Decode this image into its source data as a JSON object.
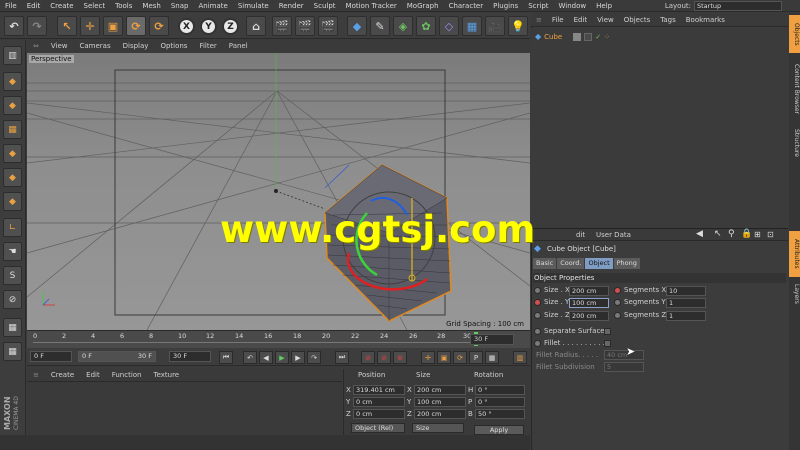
{
  "menubar": {
    "items": [
      "File",
      "Edit",
      "Create",
      "Select",
      "Tools",
      "Mesh",
      "Snap",
      "Animate",
      "Simulate",
      "Render",
      "Sculpt",
      "Motion Tracker",
      "MoGraph",
      "Character",
      "Plugins",
      "Script",
      "Window",
      "Help"
    ],
    "layout_label": "Layout:",
    "layout_value": "Startup"
  },
  "toolbar": {
    "axis_x": "X",
    "axis_y": "Y",
    "axis_z": "Z"
  },
  "viewport": {
    "menu": [
      "View",
      "Cameras",
      "Display",
      "Options",
      "Filter",
      "Panel"
    ],
    "label": "Perspective",
    "grid_spacing": "Grid Spacing : 100 cm",
    "watermark": "www.cgtsj.com"
  },
  "timeline": {
    "ticks": [
      "0",
      "2",
      "4",
      "6",
      "8",
      "10",
      "12",
      "14",
      "16",
      "18",
      "20",
      "22",
      "24",
      "26",
      "28",
      "30"
    ],
    "current_frame": "30 F"
  },
  "playback": {
    "start": "0 F",
    "min": "0 F",
    "max": "30 F",
    "end": "30 F"
  },
  "material_manager": {
    "menu": [
      "Create",
      "Edit",
      "Function",
      "Texture"
    ]
  },
  "coordinates": {
    "headers": {
      "position": "Position",
      "size": "Size",
      "rotation": "Rotation"
    },
    "rows": [
      {
        "axis": "X",
        "pos": "319.401 cm",
        "size_axis": "X",
        "size": "200 cm",
        "rot_axis": "H",
        "rot": "0 °"
      },
      {
        "axis": "Y",
        "pos": "0 cm",
        "size_axis": "Y",
        "size": "100 cm",
        "rot_axis": "P",
        "rot": "0 °"
      },
      {
        "axis": "Z",
        "pos": "0 cm",
        "size_axis": "Z",
        "size": "200 cm",
        "rot_axis": "B",
        "rot": "50 °"
      }
    ],
    "mode": "Object (Rel)",
    "size_mode": "Size",
    "apply": "Apply"
  },
  "object_manager": {
    "menu": [
      "File",
      "Edit",
      "View",
      "Objects",
      "Tags",
      "Bookmarks"
    ],
    "objects": [
      {
        "name": "Cube"
      }
    ]
  },
  "attributes": {
    "header_tabs": [
      "dit",
      "User Data"
    ],
    "title": "Cube Object [Cube]",
    "tabs": [
      "Basic",
      "Coord.",
      "Object",
      "Phong"
    ],
    "active_tab": "Object",
    "section": "Object Properties",
    "size_x_label": "Size . X",
    "size_x": "200 cm",
    "size_y_label": "Size . Y",
    "size_y": "100 cm",
    "size_z_label": "Size . Z",
    "size_z": "200 cm",
    "seg_x_label": "Segments X",
    "seg_x": "10",
    "seg_y_label": "Segments Y",
    "seg_y": "1",
    "seg_z_label": "Segments Z",
    "seg_z": "1",
    "separate_surfaces": "Separate Surfaces",
    "fillet": "Fillet . . . . . . . . . .",
    "fillet_radius_label": "Fillet Radius. . . . .",
    "fillet_radius": "40 cm",
    "fillet_subdivision_label": "Fillet Subdivision",
    "fillet_subdivision": "5"
  },
  "side_tabs": [
    "Objects",
    "Content Browser",
    "Structure",
    "Attributes",
    "Layers"
  ],
  "brand": {
    "line1": "MAXON",
    "line2": "CINEMA 4D"
  },
  "colors": {
    "accent_orange": "#f0a040",
    "active_tab_blue": "#7f9dc4",
    "watermark_yellow": "#ffff00"
  }
}
